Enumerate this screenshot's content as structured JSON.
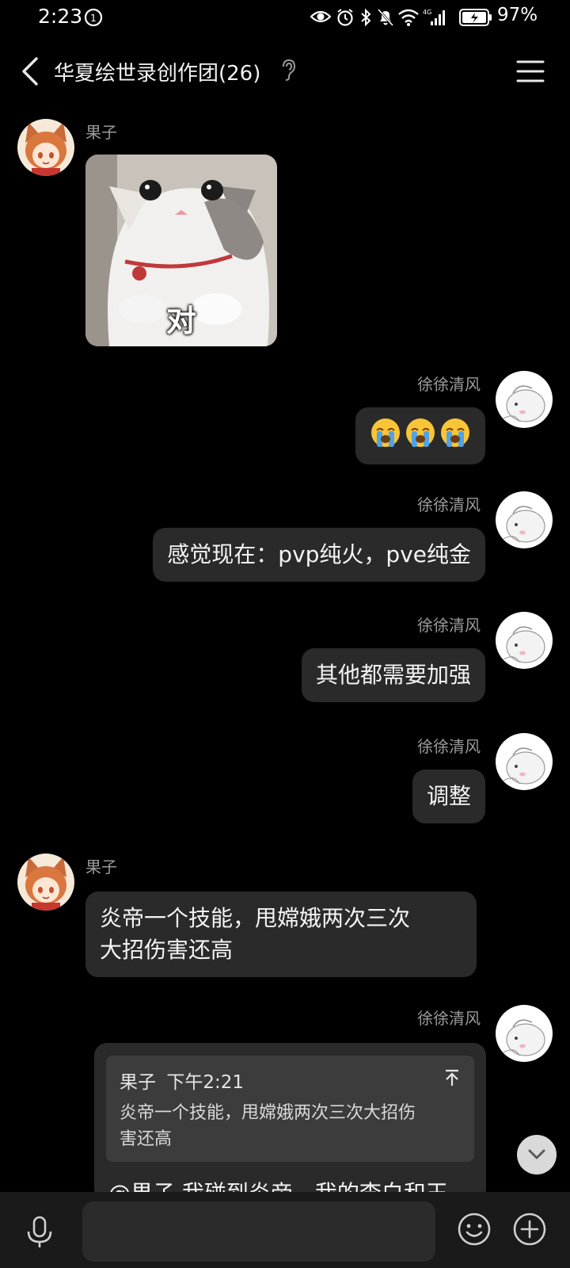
{
  "status_bar": {
    "time": "2:23",
    "battery_percent": "97%",
    "network": "4G",
    "icons": [
      "notification-app-icon",
      "eye-icon",
      "alarm-icon",
      "bluetooth-icon",
      "mute-icon",
      "wifi-icon",
      "signal-icon",
      "battery-icon"
    ]
  },
  "header": {
    "title": "华夏绘世录创作团(26)",
    "icons": [
      "back-chevron-icon",
      "ear-icon",
      "menu-icon"
    ]
  },
  "messages": [
    {
      "sender": "果子",
      "side": "left",
      "type": "sticker",
      "caption": "对"
    },
    {
      "sender": "徐徐清风",
      "side": "right",
      "type": "emoji",
      "emoji": [
        "😭",
        "😭",
        "😭"
      ]
    },
    {
      "sender": "徐徐清风",
      "side": "right",
      "type": "text",
      "text": "感觉现在：pvp纯火，pve纯金"
    },
    {
      "sender": "徐徐清风",
      "side": "right",
      "type": "text",
      "text": "其他都需要加强"
    },
    {
      "sender": "徐徐清风",
      "side": "right",
      "type": "text",
      "text": "调整"
    },
    {
      "sender": "果子",
      "side": "left",
      "type": "text",
      "lines": [
        "炎帝一个技能，甩嫦娥两次三次",
        "大招伤害还高"
      ]
    },
    {
      "sender": "徐徐清风",
      "side": "right",
      "type": "reply",
      "quote": {
        "sender": "果子",
        "time": "下午2:21",
        "lines": [
          "炎帝一个技能，甩嫦娥两次三次大招伤",
          "害还高"
        ]
      },
      "text": "@果子 我碰到炎帝，我的李白和王"
    }
  ],
  "input_bar": {
    "placeholder": "",
    "icons": [
      "mic-icon",
      "emoji-icon",
      "plus-icon"
    ]
  },
  "colors": {
    "background": "#000000",
    "bubble": "#2a2a2a",
    "quote": "#3c3c3c",
    "sender_name": "#9a9a9a",
    "input_bar": "#1a1a1a"
  }
}
